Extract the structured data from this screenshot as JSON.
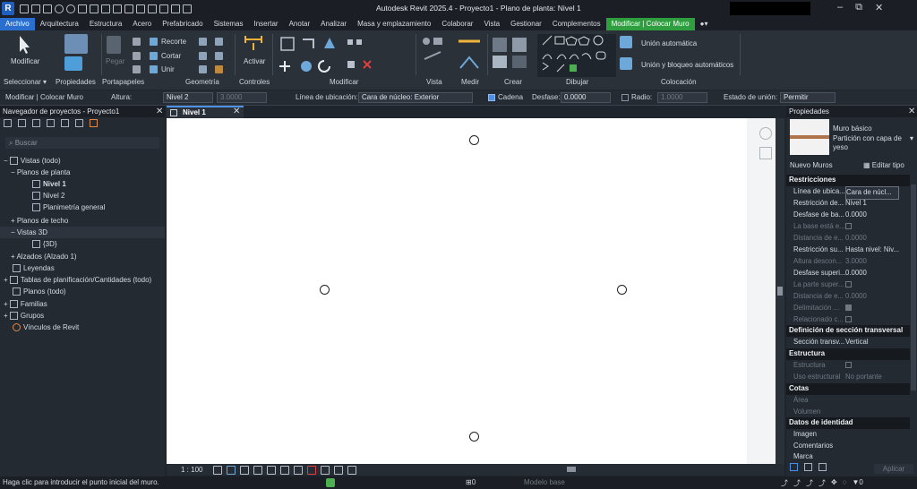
{
  "titlebar": {
    "title": "Autodesk Revit 2025.4 - Proyecto1 - Plano de planta: Nivel 1",
    "logo": "R",
    "minimize": "–",
    "restore": "⧉",
    "close": "✕"
  },
  "tabs": [
    "Archivo",
    "Arquitectura",
    "Estructura",
    "Acero",
    "Prefabricado",
    "Sistemas",
    "Insertar",
    "Anotar",
    "Analizar",
    "Masa y emplazamiento",
    "Colaborar",
    "Vista",
    "Gestionar",
    "Complementos",
    "Modificar | Colocar Muro"
  ],
  "ribbon": {
    "panels": {
      "select": "Seleccionar ▾",
      "properties": "Propiedades",
      "clipboard": "Portapapeles",
      "geometry": "Geometría",
      "controls": "Controles",
      "modify": "Modificar",
      "view": "Vista",
      "measure": "Medir",
      "create": "Crear",
      "draw": "Dibujar",
      "connection": "Colocación"
    },
    "modify_label": "Modificar",
    "paste_label": "Pegar",
    "cut_label": "Recorte",
    "join_label": "Cortar",
    "union_label": "Unir",
    "activate_label": "Activar",
    "auto_join": "Unión automática",
    "join_lock": "Unión y bloqueo automáticos"
  },
  "options": {
    "context": "Modificar | Colocar Muro",
    "height_label": "Altura:",
    "height_value": "Nivel 2",
    "height_num": "3.0000",
    "location_label": "Línea de ubicación:",
    "location_value": "Cara de núcleo: Exterior",
    "chain_label": "Cadena",
    "offset_label": "Desfase:",
    "offset_value": "0.0000",
    "radius_label": "Radio:",
    "radius_value": "1.0000",
    "join_label": "Estado de unión:",
    "join_value": "Permitir"
  },
  "browser": {
    "title": "Navegador de proyectos - Proyecto1",
    "search": "Buscar",
    "items": [
      "Vistas (todo)",
      "Planos de planta",
      "Nivel 1",
      "Nivel 2",
      "Planimetría general",
      "Planos de techo",
      "Vistas 3D",
      "{3D}",
      "Alzados (Alzado 1)",
      "Leyendas",
      "Tablas de planificación/Cantidades (todo)",
      "Planos (todo)",
      "Familias",
      "Grupos",
      "Vínculos de Revit"
    ]
  },
  "view": {
    "tab": "Nivel 1",
    "scale": "1 : 100"
  },
  "props": {
    "title": "Propiedades",
    "type_name": "Muro básico",
    "type_sub": "Partición con capa de yeso",
    "new_instance": "Nuevo Muros",
    "edit_type": "Editar tipo",
    "apply": "Aplicar",
    "sections": {
      "constraints": "Restricciones",
      "cross": "Definición de sección transversal",
      "structure": "Estructura",
      "dims": "Cotas",
      "identity": "Datos de identidad"
    },
    "rows": [
      {
        "k": "Línea de ubica...",
        "v": "Cara de núcl..."
      },
      {
        "k": "Restricción de...",
        "v": "Nivel 1"
      },
      {
        "k": "Desfase de ba...",
        "v": "0.0000"
      },
      {
        "k": "La base está e...",
        "v": ""
      },
      {
        "k": "Distancia de e...",
        "v": "0.0000"
      },
      {
        "k": "Restricción su...",
        "v": "Hasta nivel: Niv..."
      },
      {
        "k": "Altura descon...",
        "v": "3.0000"
      },
      {
        "k": "Desfase superi...",
        "v": "0.0000"
      },
      {
        "k": "La parte super...",
        "v": ""
      },
      {
        "k": "Distancia de e...",
        "v": "0.0000"
      },
      {
        "k": "Delimitación ...",
        "v": ""
      },
      {
        "k": "Relacionado c...",
        "v": ""
      },
      {
        "k": "Sección transv...",
        "v": "Vertical"
      },
      {
        "k": "Estructura",
        "v": ""
      },
      {
        "k": "Uso estructural",
        "v": "No portante"
      },
      {
        "k": "Área",
        "v": ""
      },
      {
        "k": "Volumen",
        "v": ""
      },
      {
        "k": "Imagen",
        "v": ""
      },
      {
        "k": "Comentarios",
        "v": ""
      },
      {
        "k": "Marca",
        "v": ""
      }
    ]
  },
  "status": {
    "message": "Haga clic para introducir el punto inicial del muro.",
    "model": "Modelo base",
    "zero1": "0",
    "zero2": ":0",
    "zero3": "0"
  }
}
